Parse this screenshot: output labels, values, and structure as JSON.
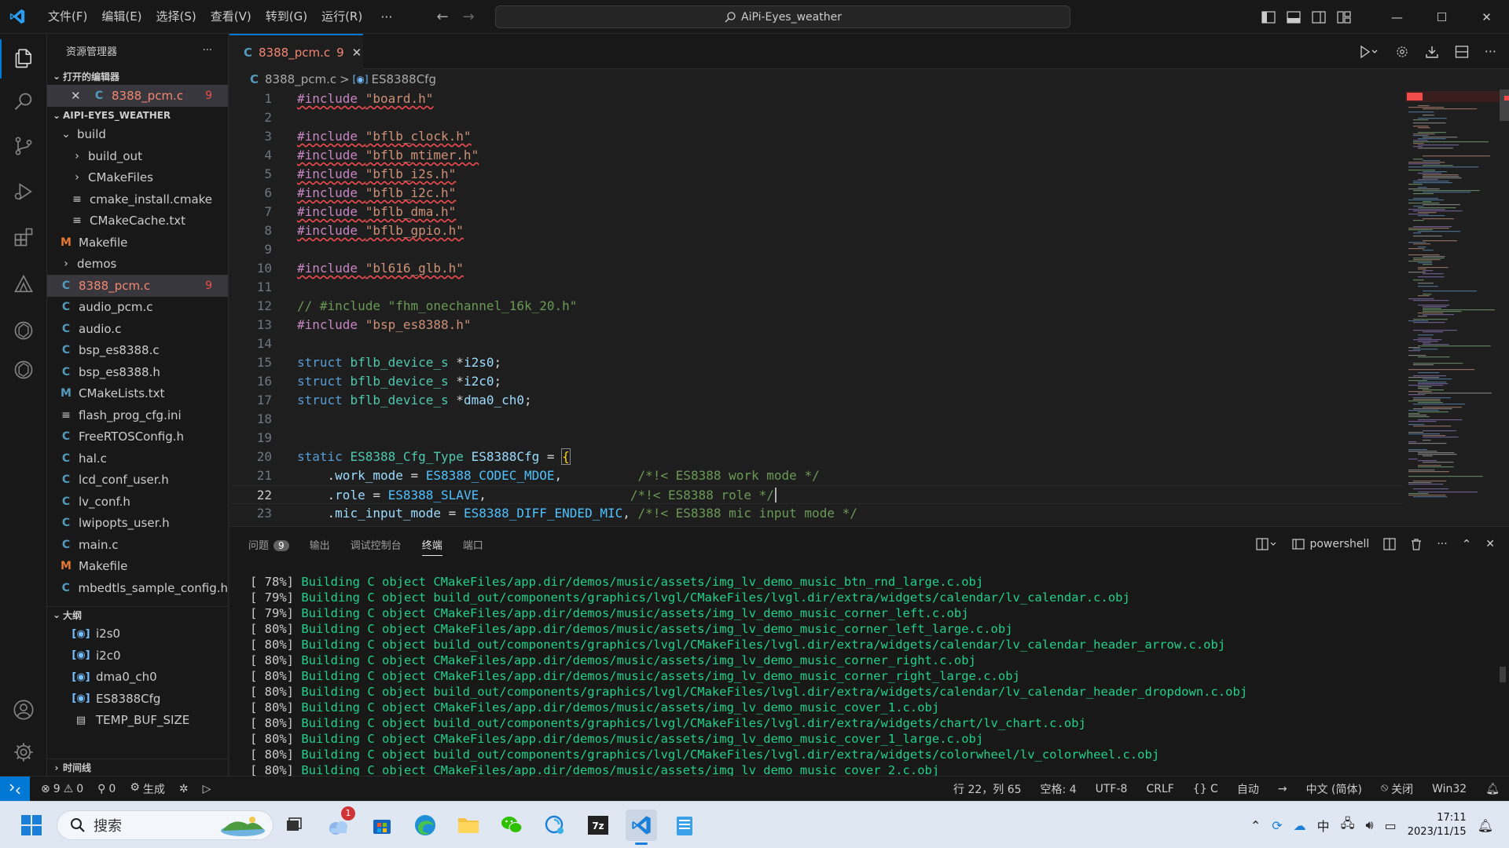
{
  "titlebar": {
    "menus": [
      "文件(F)",
      "编辑(E)",
      "选择(S)",
      "查看(V)",
      "转到(G)",
      "运行(R)"
    ],
    "more": "···",
    "search": "AiPi-Eyes_weather"
  },
  "sidebar": {
    "title": "资源管理器",
    "more": "···",
    "open_editors": {
      "label": "打开的编辑器",
      "item": "8388_pcm.c",
      "badge": "9"
    },
    "workspace": {
      "label": "AIPI-EYES_WEATHER",
      "tree": [
        {
          "name": "build",
          "kind": "folder-open",
          "indent": 1
        },
        {
          "name": "build_out",
          "kind": "folder",
          "indent": 2
        },
        {
          "name": "CMakeFiles",
          "kind": "folder",
          "indent": 2
        },
        {
          "name": "cmake_install.cmake",
          "kind": "txt",
          "indent": 2
        },
        {
          "name": "CMakeCache.txt",
          "kind": "txt",
          "indent": 2
        },
        {
          "name": "Makefile",
          "kind": "m",
          "indent": 1
        },
        {
          "name": "demos",
          "kind": "folder",
          "indent": 1
        },
        {
          "name": "8388_pcm.c",
          "kind": "c",
          "indent": 1,
          "badge": "9",
          "selected": true,
          "error": true
        },
        {
          "name": "audio_pcm.c",
          "kind": "c",
          "indent": 1
        },
        {
          "name": "audio.c",
          "kind": "c",
          "indent": 1
        },
        {
          "name": "bsp_es8388.c",
          "kind": "c",
          "indent": 1
        },
        {
          "name": "bsp_es8388.h",
          "kind": "c",
          "indent": 1
        },
        {
          "name": "CMakeLists.txt",
          "kind": "cm",
          "indent": 1
        },
        {
          "name": "flash_prog_cfg.ini",
          "kind": "txt",
          "indent": 1
        },
        {
          "name": "FreeRTOSConfig.h",
          "kind": "c",
          "indent": 1
        },
        {
          "name": "hal.c",
          "kind": "c",
          "indent": 1
        },
        {
          "name": "lcd_conf_user.h",
          "kind": "c",
          "indent": 1
        },
        {
          "name": "lv_conf.h",
          "kind": "c",
          "indent": 1
        },
        {
          "name": "lwipopts_user.h",
          "kind": "c",
          "indent": 1
        },
        {
          "name": "main.c",
          "kind": "c",
          "indent": 1
        },
        {
          "name": "Makefile",
          "kind": "m",
          "indent": 1
        },
        {
          "name": "mbedtls_sample_config.h",
          "kind": "c",
          "indent": 1
        }
      ]
    },
    "outline": {
      "label": "大纲",
      "items": [
        {
          "name": "i2s0",
          "kind": "sym"
        },
        {
          "name": "i2c0",
          "kind": "sym"
        },
        {
          "name": "dma0_ch0",
          "kind": "sym"
        },
        {
          "name": "ES8388Cfg",
          "kind": "sym"
        },
        {
          "name": "TEMP_BUF_SIZE",
          "kind": "const"
        }
      ]
    },
    "timeline": {
      "label": "时间线"
    }
  },
  "editor": {
    "tab": {
      "label": "8388_pcm.c",
      "problems": "9",
      "icon": "C"
    },
    "breadcrumb": {
      "file": "8388_pcm.c",
      "sep": ">",
      "symbol": "ES8388Cfg"
    },
    "current_line": 22,
    "lines": [
      {
        "n": "1",
        "tokens": [
          {
            "c": "kw-pp squig",
            "t": "#include "
          },
          {
            "c": "str squig",
            "t": "\"board.h\""
          }
        ]
      },
      {
        "n": "2",
        "tokens": []
      },
      {
        "n": "3",
        "tokens": [
          {
            "c": "kw-pp squig",
            "t": "#include "
          },
          {
            "c": "str squig",
            "t": "\"bflb_clock.h\""
          }
        ]
      },
      {
        "n": "4",
        "tokens": [
          {
            "c": "kw-pp squig",
            "t": "#include "
          },
          {
            "c": "str squig",
            "t": "\"bflb_mtimer.h\""
          }
        ]
      },
      {
        "n": "5",
        "tokens": [
          {
            "c": "kw-pp squig",
            "t": "#include "
          },
          {
            "c": "str squig",
            "t": "\"bflb_i2s.h\""
          }
        ]
      },
      {
        "n": "6",
        "tokens": [
          {
            "c": "kw-pp squig",
            "t": "#include "
          },
          {
            "c": "str squig",
            "t": "\"bflb_i2c.h\""
          }
        ]
      },
      {
        "n": "7",
        "tokens": [
          {
            "c": "kw-pp squig",
            "t": "#include "
          },
          {
            "c": "str squig",
            "t": "\"bflb_dma.h\""
          }
        ]
      },
      {
        "n": "8",
        "tokens": [
          {
            "c": "kw-pp squig",
            "t": "#include "
          },
          {
            "c": "str squig",
            "t": "\"bflb_gpio.h\""
          }
        ]
      },
      {
        "n": "9",
        "tokens": []
      },
      {
        "n": "10",
        "tokens": [
          {
            "c": "kw-pp squig",
            "t": "#include "
          },
          {
            "c": "str squig",
            "t": "\"bl616_glb.h\""
          }
        ]
      },
      {
        "n": "11",
        "tokens": []
      },
      {
        "n": "12",
        "tokens": [
          {
            "c": "cmt",
            "t": "// #include \"fhm_onechannel_16k_20.h\""
          }
        ]
      },
      {
        "n": "13",
        "tokens": [
          {
            "c": "kw-pp",
            "t": "#include "
          },
          {
            "c": "str",
            "t": "\"bsp_es8388.h\""
          }
        ]
      },
      {
        "n": "14",
        "tokens": []
      },
      {
        "n": "15",
        "tokens": [
          {
            "c": "kw",
            "t": "struct "
          },
          {
            "c": "type",
            "t": "bflb_device_s "
          },
          {
            "c": "plain",
            "t": "*"
          },
          {
            "c": "var",
            "t": "i2s0"
          },
          {
            "c": "plain",
            "t": ";"
          }
        ]
      },
      {
        "n": "16",
        "tokens": [
          {
            "c": "kw",
            "t": "struct "
          },
          {
            "c": "type",
            "t": "bflb_device_s "
          },
          {
            "c": "plain",
            "t": "*"
          },
          {
            "c": "var",
            "t": "i2c0"
          },
          {
            "c": "plain",
            "t": ";"
          }
        ]
      },
      {
        "n": "17",
        "tokens": [
          {
            "c": "kw",
            "t": "struct "
          },
          {
            "c": "type",
            "t": "bflb_device_s "
          },
          {
            "c": "plain",
            "t": "*"
          },
          {
            "c": "var",
            "t": "dma0_ch0"
          },
          {
            "c": "plain",
            "t": ";"
          }
        ]
      },
      {
        "n": "18",
        "tokens": []
      },
      {
        "n": "19",
        "tokens": []
      },
      {
        "n": "20",
        "tokens": [
          {
            "c": "kw",
            "t": "static "
          },
          {
            "c": "type",
            "t": "ES8388_Cfg_Type "
          },
          {
            "c": "var",
            "t": "ES8388Cfg"
          },
          {
            "c": "plain",
            "t": " = "
          },
          {
            "c": "brk",
            "t": "{"
          }
        ]
      },
      {
        "n": "21",
        "tokens": [
          {
            "c": "plain",
            "t": "    ."
          },
          {
            "c": "var",
            "t": "work_mode"
          },
          {
            "c": "plain",
            "t": " = "
          },
          {
            "c": "enm",
            "t": "ES8388_CODEC_MDOE"
          },
          {
            "c": "plain",
            "t": ",          "
          },
          {
            "c": "cmt",
            "t": "/*!< ES8388 work mode */"
          }
        ]
      },
      {
        "n": "22",
        "tokens": [
          {
            "c": "plain",
            "t": "    ."
          },
          {
            "c": "var",
            "t": "role"
          },
          {
            "c": "plain",
            "t": " = "
          },
          {
            "c": "enm",
            "t": "ES8388_SLAVE"
          },
          {
            "c": "plain",
            "t": ",                   "
          },
          {
            "c": "cmt",
            "t": "/*!< ES8388 role */"
          }
        ]
      },
      {
        "n": "23",
        "tokens": [
          {
            "c": "plain",
            "t": "    ."
          },
          {
            "c": "var",
            "t": "mic_input_mode"
          },
          {
            "c": "plain",
            "t": " = "
          },
          {
            "c": "enm",
            "t": "ES8388_DIFF_ENDED_MIC"
          },
          {
            "c": "plain",
            "t": ", "
          },
          {
            "c": "cmt",
            "t": "/*!< ES8388 mic input mode */"
          }
        ]
      }
    ]
  },
  "panel": {
    "tabs": [
      {
        "label": "问题",
        "badge": "9"
      },
      {
        "label": "输出"
      },
      {
        "label": "调试控制台"
      },
      {
        "label": "终端",
        "active": true
      },
      {
        "label": "端口"
      }
    ],
    "shell": "powershell",
    "more": "···",
    "terminal_lines": [
      {
        "pct": "[ 78%]",
        "msg": "Building C object CMakeFiles/app.dir/demos/music/assets/img_lv_demo_music_btn_rnd_large.c.obj"
      },
      {
        "pct": "[ 79%]",
        "msg": "Building C object build_out/components/graphics/lvgl/CMakeFiles/lvgl.dir/extra/widgets/calendar/lv_calendar.c.obj"
      },
      {
        "pct": "[ 79%]",
        "msg": "Building C object CMakeFiles/app.dir/demos/music/assets/img_lv_demo_music_corner_left.c.obj"
      },
      {
        "pct": "[ 80%]",
        "msg": "Building C object CMakeFiles/app.dir/demos/music/assets/img_lv_demo_music_corner_left_large.c.obj"
      },
      {
        "pct": "[ 80%]",
        "msg": "Building C object build_out/components/graphics/lvgl/CMakeFiles/lvgl.dir/extra/widgets/calendar/lv_calendar_header_arrow.c.obj"
      },
      {
        "pct": "[ 80%]",
        "msg": "Building C object CMakeFiles/app.dir/demos/music/assets/img_lv_demo_music_corner_right.c.obj"
      },
      {
        "pct": "[ 80%]",
        "msg": "Building C object CMakeFiles/app.dir/demos/music/assets/img_lv_demo_music_corner_right_large.c.obj"
      },
      {
        "pct": "[ 80%]",
        "msg": "Building C object build_out/components/graphics/lvgl/CMakeFiles/lvgl.dir/extra/widgets/calendar/lv_calendar_header_dropdown.c.obj"
      },
      {
        "pct": "[ 80%]",
        "msg": "Building C object CMakeFiles/app.dir/demos/music/assets/img_lv_demo_music_cover_1.c.obj"
      },
      {
        "pct": "[ 80%]",
        "msg": "Building C object build_out/components/graphics/lvgl/CMakeFiles/lvgl.dir/extra/widgets/chart/lv_chart.c.obj"
      },
      {
        "pct": "[ 80%]",
        "msg": "Building C object CMakeFiles/app.dir/demos/music/assets/img_lv_demo_music_cover_1_large.c.obj"
      },
      {
        "pct": "[ 80%]",
        "msg": "Building C object build_out/components/graphics/lvgl/CMakeFiles/lvgl.dir/extra/widgets/colorwheel/lv_colorwheel.c.obj"
      },
      {
        "pct": "[ 80%]",
        "msg": "Building C object CMakeFiles/app.dir/demos/music/assets/img_lv_demo_music_cover_2.c.obj"
      }
    ]
  },
  "statusbar": {
    "errors": "9",
    "warnings": "0",
    "ports": "0",
    "build": "生成",
    "position": "行 22，列 65",
    "spaces": "空格: 4",
    "encoding": "UTF-8",
    "eol": "CRLF",
    "language": "{} C",
    "auto": "自动",
    "locale": "中文 (简体)",
    "copilot": "关闭",
    "platform": "Win32"
  },
  "taskbar": {
    "search": "搜索",
    "weather_badge": "1",
    "ime": "中",
    "time": "17:11",
    "date": "2023/11/15"
  },
  "colors": {
    "accent": "#0078d4",
    "error": "#f48771",
    "terminal_green": "#23d18b"
  }
}
